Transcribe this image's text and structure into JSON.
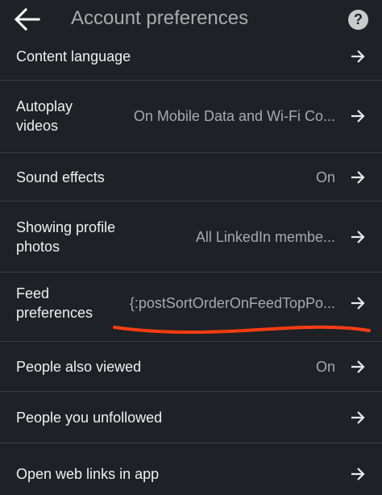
{
  "header": {
    "title": "Account preferences",
    "help_label": "?"
  },
  "rows": [
    {
      "label": "Content language",
      "value": ""
    },
    {
      "label_line1": "Autoplay",
      "label_line2": "videos",
      "value": "On Mobile Data and Wi-Fi Co..."
    },
    {
      "label": "Sound effects",
      "value": "On"
    },
    {
      "label_line1": "Showing profile",
      "label_line2": "photos",
      "value": "All LinkedIn membe..."
    },
    {
      "label_line1": "Feed",
      "label_line2": "preferences",
      "value": "{:postSortOrderOnFeedTopPo..."
    },
    {
      "label": "People also viewed",
      "value": "On"
    },
    {
      "label": "People you unfollowed",
      "value": ""
    },
    {
      "label": "Open web links in app",
      "value": ""
    }
  ],
  "colors": {
    "background": "#1e2226",
    "divider": "#3a3e43",
    "annotation": "#ff3d12"
  },
  "icons": {
    "back": "arrow-left-icon",
    "help": "question-circle-icon",
    "row_arrow": "arrow-right-icon"
  }
}
